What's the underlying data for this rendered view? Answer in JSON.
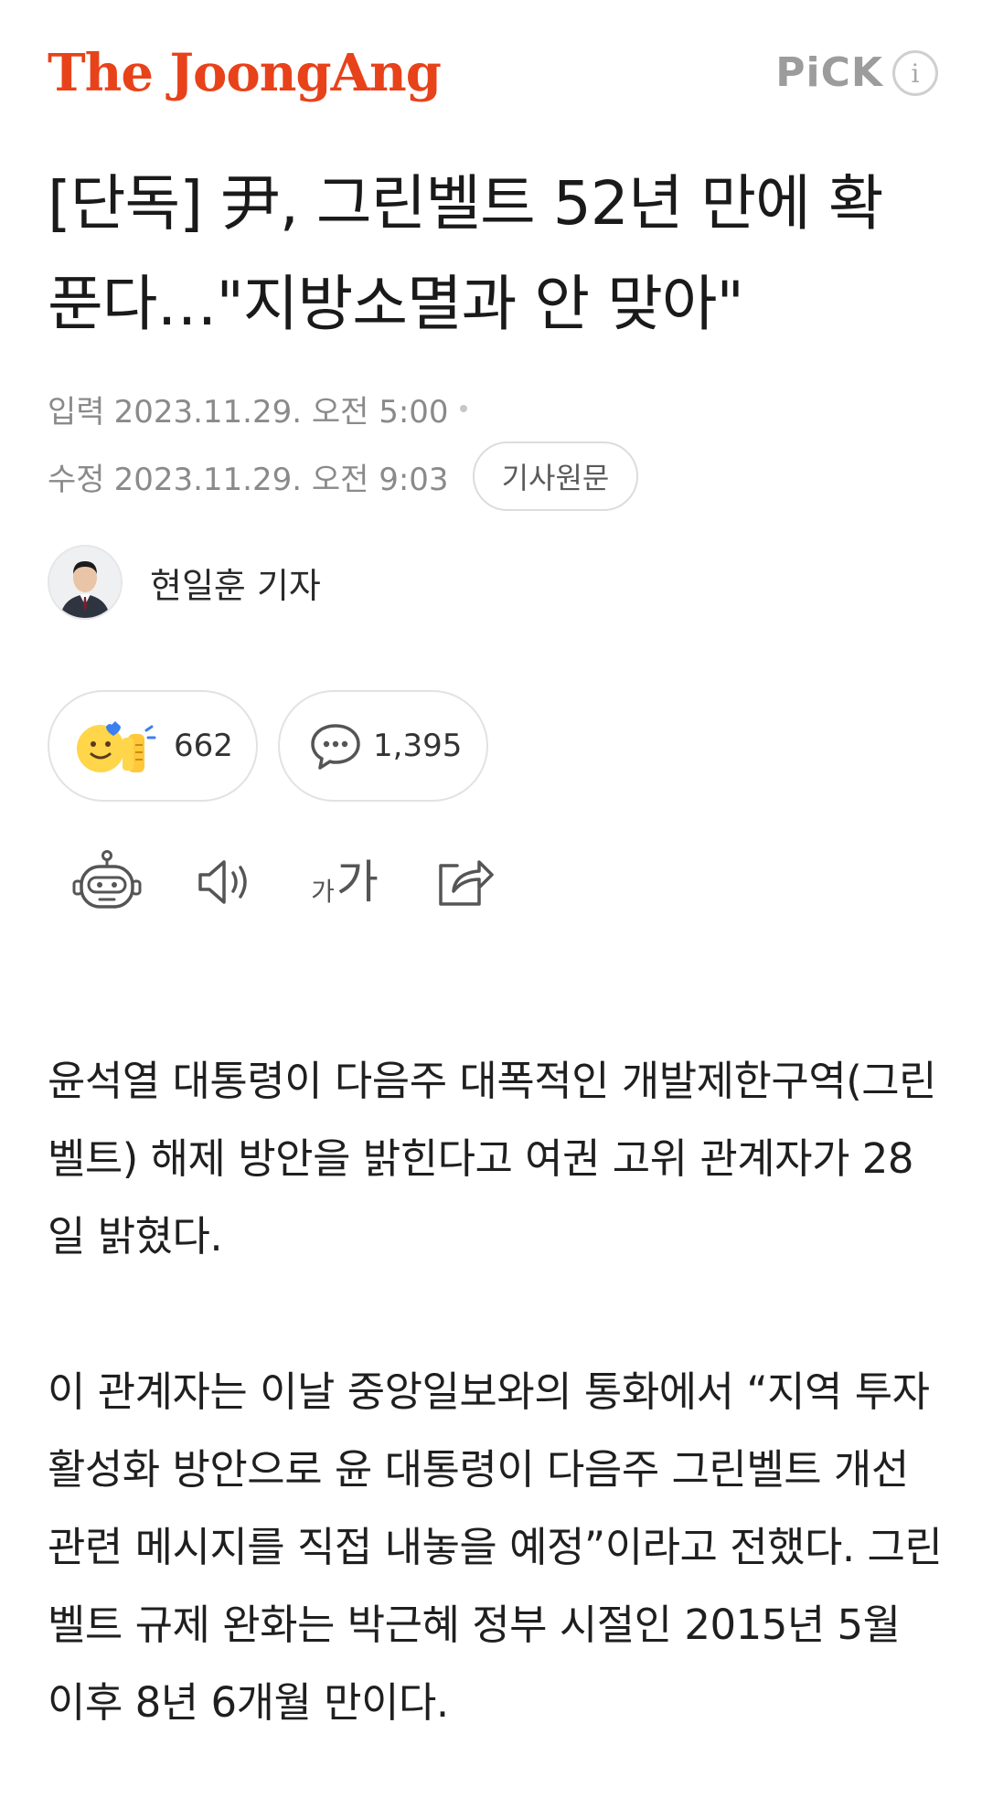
{
  "header": {
    "brand": "The JoongAng",
    "pick_label": "PiCK",
    "info_icon": "info-icon"
  },
  "article": {
    "headline": "[단독] 尹, 그린벨트 52년 만에 확 푼다…\"지방소멸과 안 맞아\"",
    "published_label": "입력",
    "published": "2023.11.29. 오전 5:00",
    "modified_label": "수정",
    "modified": "2023.11.29. 오전 9:03",
    "original_button": "기사원문",
    "author": "현일훈 기자",
    "paragraphs": [
      "윤석열 대통령이 다음주 대폭적인 개발제한구역(그린벨트) 해제 방안을 밝힌다고 여권 고위 관계자가 28일 밝혔다.",
      "이 관계자는 이날 중앙일보와의 통화에서 “지역 투자 활성화 방안으로 윤 대통령이 다음주 그린벨트 개선 관련 메시지를 직접 내놓을 예정”이라고 전했다. 그린벨트 규제 완화는 박근혜 정부 시절인 2015년 5월 이후 8년 6개월 만이다."
    ]
  },
  "reactions": {
    "like_count": "662",
    "comment_count": "1,395"
  },
  "toolbar": {
    "icons": [
      "robot-summary-icon",
      "speaker-icon",
      "font-size-icon",
      "share-icon"
    ],
    "font_small": "가",
    "font_big": "가"
  },
  "colors": {
    "brand": "#e8421a",
    "pick": "#9c9c9c",
    "meta": "#8a8a8a",
    "text": "#1f1f1f"
  }
}
